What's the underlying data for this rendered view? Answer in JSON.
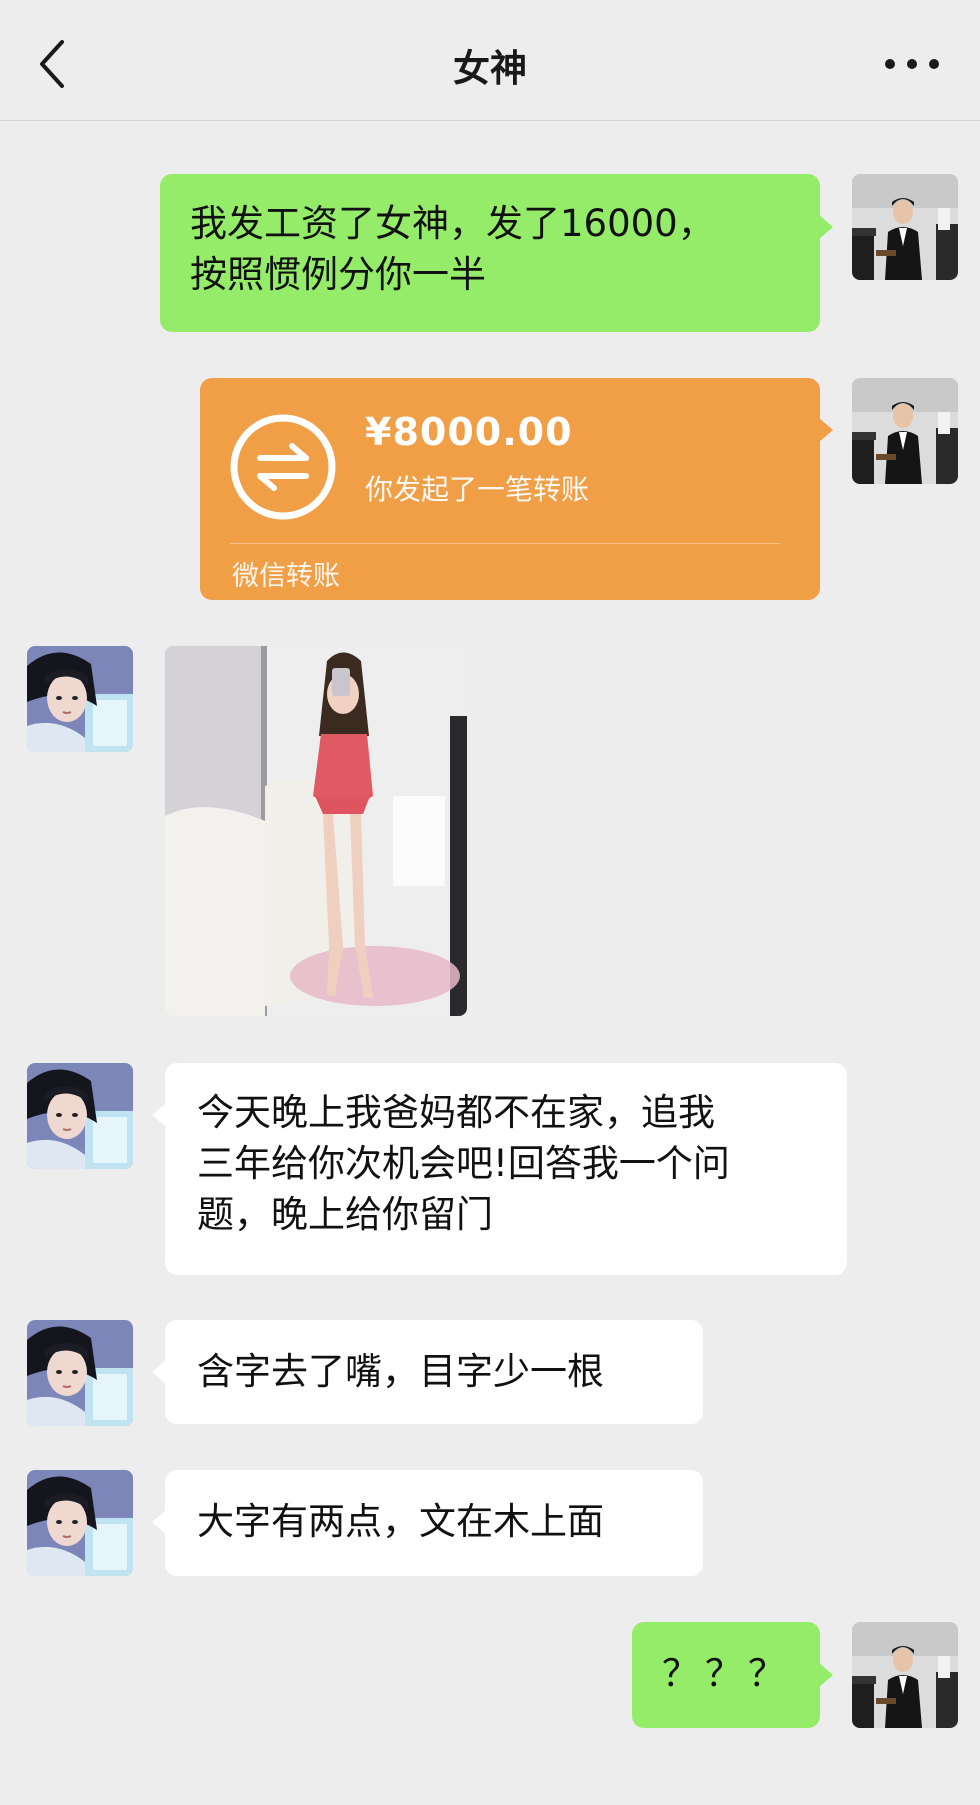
{
  "header": {
    "title": "女神",
    "back_icon": "chevron-left-icon",
    "more_icon": "more-dots-icon"
  },
  "messages": {
    "m1": {
      "sender": "me",
      "line1": "我发工资了女神，发了16000，",
      "line2": "按照惯例分你一半"
    },
    "m2": {
      "sender": "me",
      "type": "transfer",
      "amount": "¥8000.00",
      "note": "你发起了一笔转账",
      "footer": "微信转账",
      "icon": "transfer-arrows-icon"
    },
    "m3": {
      "sender": "her",
      "type": "image"
    },
    "m4": {
      "sender": "her",
      "line1": "今天晚上我爸妈都不在家，追我",
      "line2": "三年给你次机会吧!回答我一个问",
      "line3": "题，晚上给你留门"
    },
    "m5": {
      "sender": "her",
      "text": "含字去了嘴，目字少一根"
    },
    "m6": {
      "sender": "her",
      "text": "大字有两点，文在木上面"
    },
    "m7": {
      "sender": "me",
      "text": "？？？"
    }
  },
  "colors": {
    "background": "#ededed",
    "my_bubble": "#95ec69",
    "her_bubble": "#ffffff",
    "transfer_card": "#f19f47"
  }
}
